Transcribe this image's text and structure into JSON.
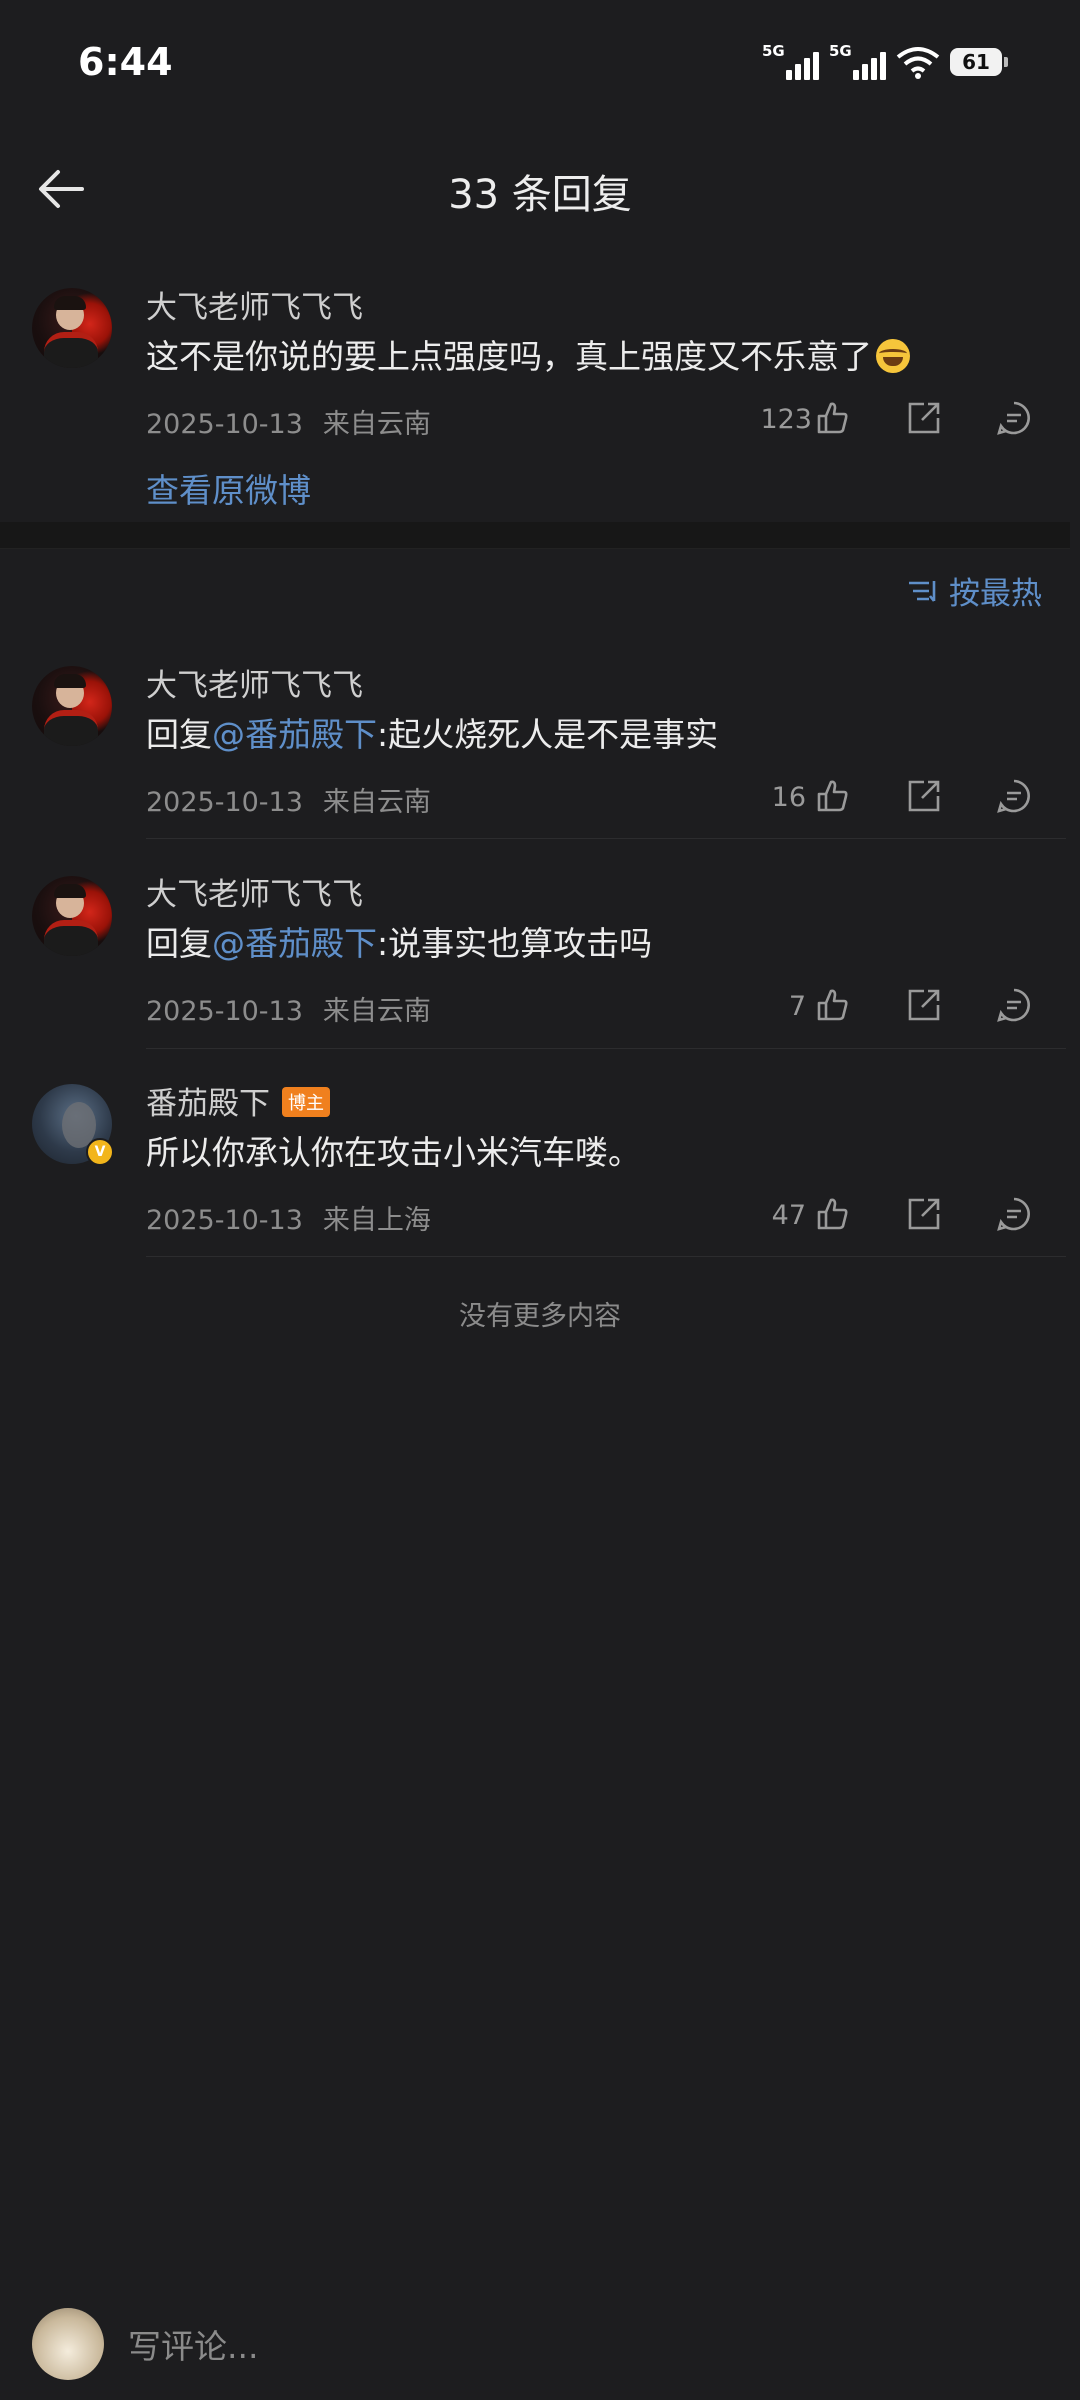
{
  "status": {
    "time": "6:44",
    "net1": "5G",
    "net2": "5G",
    "battery": "61"
  },
  "header": {
    "title": "33 条回复"
  },
  "main_comment": {
    "author": "大飞老师飞飞飞",
    "text": "这不是你说的要上点强度吗，真上强度又不乐意了",
    "emoji": "grinning-sweat-emoji",
    "date": "2025-10-13",
    "location": "来自云南",
    "likes": "123",
    "view_original": "查看原微博"
  },
  "sort": {
    "label": "按最热"
  },
  "replies": [
    {
      "author": "大飞老师飞飞飞",
      "prefix": "回复",
      "mention": "@番茄殿下",
      "text": ":起火烧死人是不是事实",
      "date": "2025-10-13",
      "location": "来自云南",
      "likes": "16"
    },
    {
      "author": "大飞老师飞飞飞",
      "prefix": "回复",
      "mention": "@番茄殿下",
      "text": ":说事实也算攻击吗",
      "date": "2025-10-13",
      "location": "来自云南",
      "likes": "7"
    },
    {
      "author": "番茄殿下",
      "badge": "博主",
      "verified": "V",
      "text": "所以你承认你在攻击小米汽车喽。",
      "date": "2025-10-13",
      "location": "来自上海",
      "likes": "47"
    }
  ],
  "footer": {
    "no_more": "没有更多内容",
    "comment_placeholder": "写评论..."
  },
  "colors": {
    "background": "#1d1d1f",
    "link": "#5f8fc9",
    "badge": "#f0801e"
  }
}
